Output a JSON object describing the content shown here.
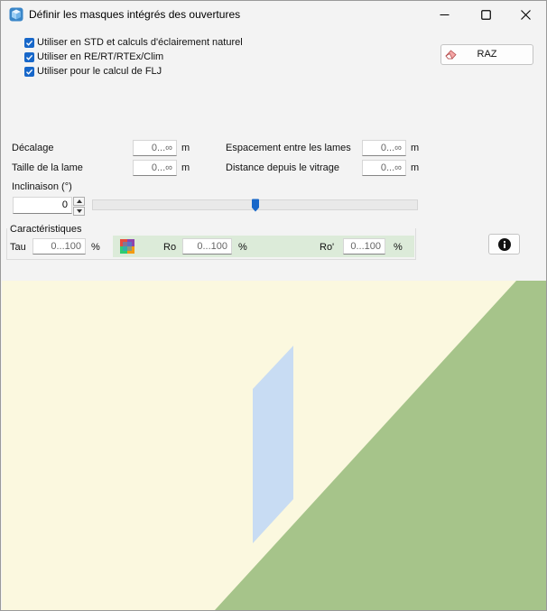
{
  "window": {
    "title": "Définir les masques intégrés des ouvertures",
    "icons": {
      "app": "app-icon",
      "minimize": "minimize-icon",
      "maximize": "maximize-icon",
      "close": "close-icon"
    }
  },
  "checkboxes": [
    {
      "label": "Utiliser en STD et calculs d'éclairement naturel",
      "checked": true
    },
    {
      "label": "Utiliser en RE/RT/RTEx/Clim",
      "checked": true
    },
    {
      "label": "Utiliser pour le calcul de FLJ",
      "checked": true
    }
  ],
  "raz_button": {
    "label": "RAZ",
    "icon": "eraser-icon"
  },
  "fields": {
    "decalage": {
      "label": "Décalage",
      "placeholder": "0...∞",
      "unit": "m"
    },
    "taille_lame": {
      "label": "Taille de la lame",
      "placeholder": "0...∞",
      "unit": "m"
    },
    "espacement": {
      "label": "Espacement entre les lames",
      "placeholder": "0...∞",
      "unit": "m"
    },
    "distance_vitrage": {
      "label": "Distance depuis le vitrage",
      "placeholder": "0...∞",
      "unit": "m"
    }
  },
  "inclinaison": {
    "label": "Inclinaison (°)",
    "value": "0",
    "slider_fraction": 0.5
  },
  "caracteristiques": {
    "title": "Caractéristiques",
    "tau": {
      "label": "Tau",
      "placeholder": "0...100",
      "unit": "%"
    },
    "ro": {
      "label": "Ro",
      "placeholder": "0...100",
      "unit": "%"
    },
    "ro_prime": {
      "label": "Ro'",
      "placeholder": "0...100",
      "unit": "%"
    },
    "palette_icon": "color-palette-icon",
    "info_icon": "info-icon"
  },
  "preview": {
    "colors": {
      "background": "#fbf8df",
      "ground": "#a6c48a",
      "glass": "#c8dcf3"
    }
  }
}
